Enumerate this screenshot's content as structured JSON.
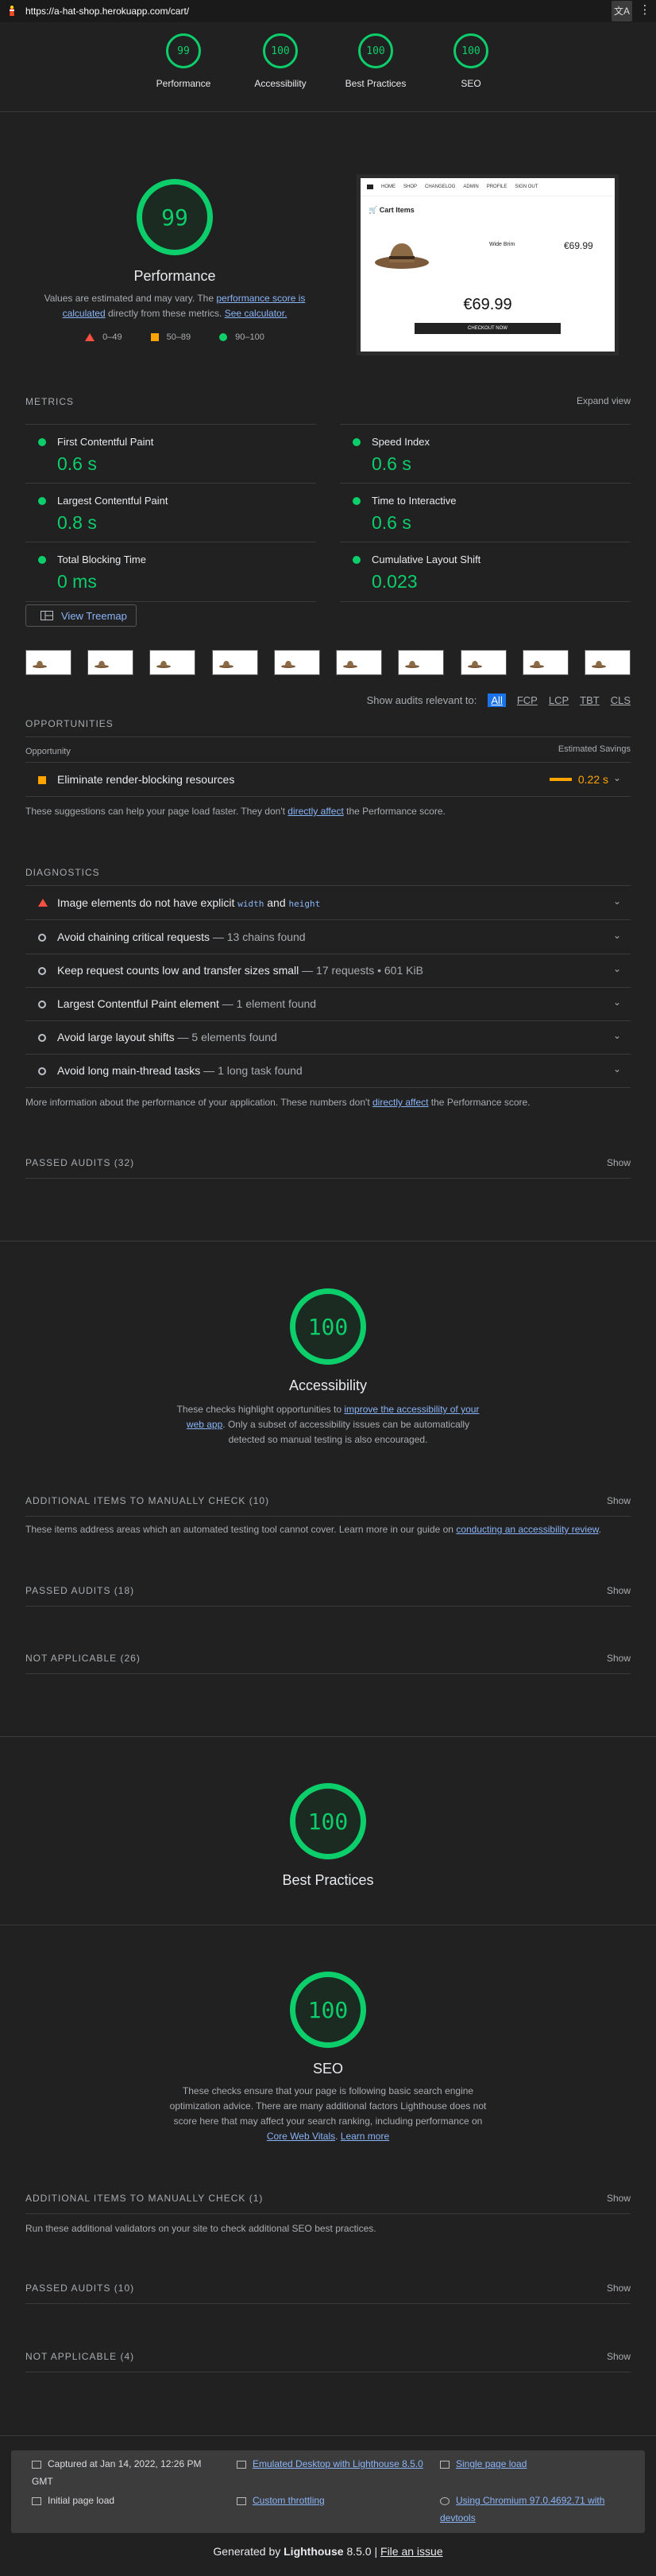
{
  "browser": {
    "url": "https://a-hat-shop.herokuapp.com/cart/"
  },
  "gauges": [
    {
      "score": "99",
      "label": "Performance"
    },
    {
      "score": "100",
      "label": "Accessibility"
    },
    {
      "score": "100",
      "label": "Best Practices"
    },
    {
      "score": "100",
      "label": "SEO"
    }
  ],
  "performance": {
    "score": "99",
    "title": "Performance",
    "note_prefix": "Values are estimated and may vary. The ",
    "note_link1": "performance score is calculated",
    "note_mid": " directly from these metrics. ",
    "note_link2": "See calculator.",
    "legend": [
      "0–49",
      "50–89",
      "90–100"
    ],
    "screenshot": {
      "nav": [
        "HOME",
        "SHOP",
        "CHANGELOG",
        "ADMIN",
        "PROFILE",
        "SIGN OUT"
      ],
      "heading": "Cart Items",
      "product": "Wide Brim",
      "price": "€69.99",
      "total": "€69.99",
      "checkout": "CHECKOUT NOW"
    },
    "metrics_label": "METRICS",
    "expand_view": "Expand view",
    "metrics": [
      {
        "name": "First Contentful Paint",
        "value": "0.6 s"
      },
      {
        "name": "Speed Index",
        "value": "0.6 s"
      },
      {
        "name": "Largest Contentful Paint",
        "value": "0.8 s"
      },
      {
        "name": "Time to Interactive",
        "value": "0.6 s"
      },
      {
        "name": "Total Blocking Time",
        "value": "0 ms"
      },
      {
        "name": "Cumulative Layout Shift",
        "value": "0.023"
      }
    ],
    "treemap": "View Treemap",
    "relevant_label": "Show audits relevant to:",
    "relevant_chips": [
      "All",
      "FCP",
      "LCP",
      "TBT",
      "CLS"
    ],
    "opportunities_label": "OPPORTUNITIES",
    "opportunity_col": "Opportunity",
    "savings_col": "Estimated Savings",
    "opportunity": {
      "title": "Eliminate render-blocking resources",
      "savings": "0.22 s"
    },
    "opp_note_prefix": "These suggestions can help your page load faster. They don't ",
    "opp_note_link": "directly affect",
    "opp_note_suffix": " the Performance score.",
    "diagnostics_label": "DIAGNOSTICS",
    "diag_image": {
      "a": "Image elements do not have explicit ",
      "w": "width",
      "and": " and ",
      "h": "height"
    },
    "diagnostics": [
      {
        "title": "Avoid chaining critical requests",
        "detail": " — 13 chains found"
      },
      {
        "title": "Keep request counts low and transfer sizes small",
        "detail": " — 17 requests • 601 KiB"
      },
      {
        "title": "Largest Contentful Paint element",
        "detail": " — 1 element found"
      },
      {
        "title": "Avoid large layout shifts",
        "detail": " — 5 elements found"
      },
      {
        "title": "Avoid long main-thread tasks",
        "detail": " — 1 long task found"
      }
    ],
    "diag_note_prefix": "More information about the performance of your application. These numbers don't ",
    "diag_note_link": "directly affect",
    "diag_note_suffix": " the Performance score.",
    "passed": "PASSED AUDITS (32)"
  },
  "show": "Show",
  "accessibility": {
    "score": "100",
    "title": "Accessibility",
    "desc_prefix": "These checks highlight opportunities to ",
    "desc_link": "improve the accessibility of your web app",
    "desc_suffix": ". Only a subset of accessibility issues can be automatically detected so manual testing is also encouraged.",
    "manual": "ADDITIONAL ITEMS TO MANUALLY CHECK (10)",
    "manual_note_prefix": "These items address areas which an automated testing tool cannot cover. Learn more in our guide on ",
    "manual_note_link": "conducting an accessibility review",
    "manual_note_suffix": ".",
    "passed": "PASSED AUDITS (18)",
    "not_applicable": "NOT APPLICABLE (26)"
  },
  "best_practices": {
    "score": "100",
    "title": "Best Practices"
  },
  "seo": {
    "score": "100",
    "title": "SEO",
    "desc": "These checks ensure that your page is following basic search engine optimization advice. There are many additional factors Lighthouse does not score here that may affect your search ranking, including performance on ",
    "desc_link1": "Core Web Vitals",
    "desc_sep": ". ",
    "desc_link2": "Learn more",
    "manual": "ADDITIONAL ITEMS TO MANUALLY CHECK (1)",
    "manual_note": "Run these additional validators on your site to check additional SEO best practices.",
    "passed": "PASSED AUDITS (10)",
    "not_applicable": "NOT APPLICABLE (4)"
  },
  "footer": {
    "captured": "Captured at Jan 14, 2022, 12:26 PM GMT",
    "emulated": "Emulated Desktop with Lighthouse 8.5.0",
    "single": "Single page load",
    "initial": "Initial page load",
    "throttling": "Custom throttling",
    "chromium": "Using Chromium 97.0.4692.71 with devtools",
    "generated_prefix": "Generated by ",
    "generated_brand": "Lighthouse",
    "generated_version": " 8.5.0 | ",
    "file_issue": "File an issue"
  }
}
